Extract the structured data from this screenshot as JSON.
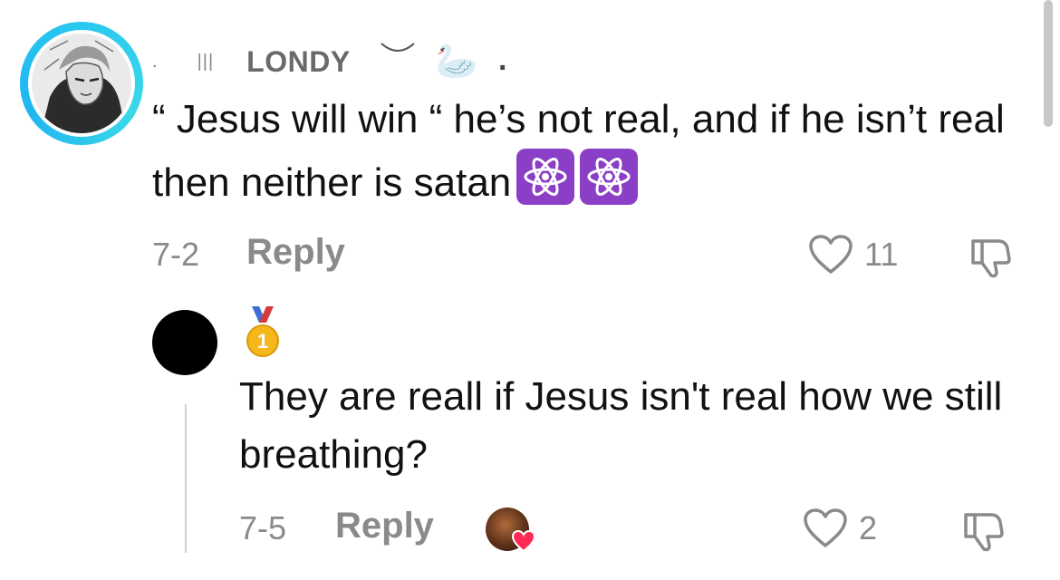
{
  "comment": {
    "username": "LONDY",
    "username_decor_left": "|||",
    "swan_emoji": "🦢",
    "text": "“ Jesus will win “ he’s not real, and if he isn’t real then neither is satan",
    "trailing_emoji": [
      "atom-symbol",
      "atom-symbol"
    ],
    "date": "7-2",
    "reply_label": "Reply",
    "like_count": "11",
    "avatar_ring_color": "#29c8f0"
  },
  "reply": {
    "badge_emoji": "1st-place-medal",
    "text": "They are reall if Jesus isn't real how we still breathing?",
    "date": "7-5",
    "reply_label": "Reply",
    "like_count": "2",
    "creator_liked": true,
    "heart_color": "#fe2c55"
  },
  "colors": {
    "meta_text": "#8a8a8a",
    "atom_bg": "#8b3fc6"
  }
}
